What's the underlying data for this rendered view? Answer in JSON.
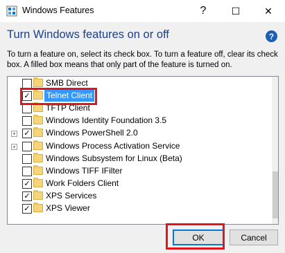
{
  "window": {
    "title": "Windows Features",
    "help_button": "?",
    "maximize_button": "☐",
    "close_button": "✕"
  },
  "heading": "Turn Windows features on or off",
  "description": "To turn a feature on, select its check box. To turn a feature off, clear its check box. A filled box means that only part of the feature is turned on.",
  "features": [
    {
      "label": "SMB Direct",
      "checked": false,
      "expandable": false
    },
    {
      "label": "Telnet Client",
      "checked": true,
      "expandable": false,
      "selected": true
    },
    {
      "label": "TFTP Client",
      "checked": false,
      "expandable": false
    },
    {
      "label": "Windows Identity Foundation 3.5",
      "checked": false,
      "expandable": false
    },
    {
      "label": "Windows PowerShell 2.0",
      "checked": true,
      "expandable": true
    },
    {
      "label": "Windows Process Activation Service",
      "checked": false,
      "expandable": true
    },
    {
      "label": "Windows Subsystem for Linux (Beta)",
      "checked": false,
      "expandable": false
    },
    {
      "label": "Windows TIFF IFilter",
      "checked": false,
      "expandable": false
    },
    {
      "label": "Work Folders Client",
      "checked": true,
      "expandable": false
    },
    {
      "label": "XPS Services",
      "checked": true,
      "expandable": false
    },
    {
      "label": "XPS Viewer",
      "checked": true,
      "expandable": false
    }
  ],
  "buttons": {
    "ok": "OK",
    "cancel": "Cancel"
  },
  "icons": {
    "title": "windows-features-icon",
    "help": "help-icon",
    "expander": "plus-expander-icon",
    "folder": "folder-icon",
    "check": "checkmark-icon"
  },
  "colors": {
    "heading": "#1b3f8b",
    "selection": "#3399ff",
    "annotation": "#e0151f",
    "folder": "#f6d57a"
  }
}
